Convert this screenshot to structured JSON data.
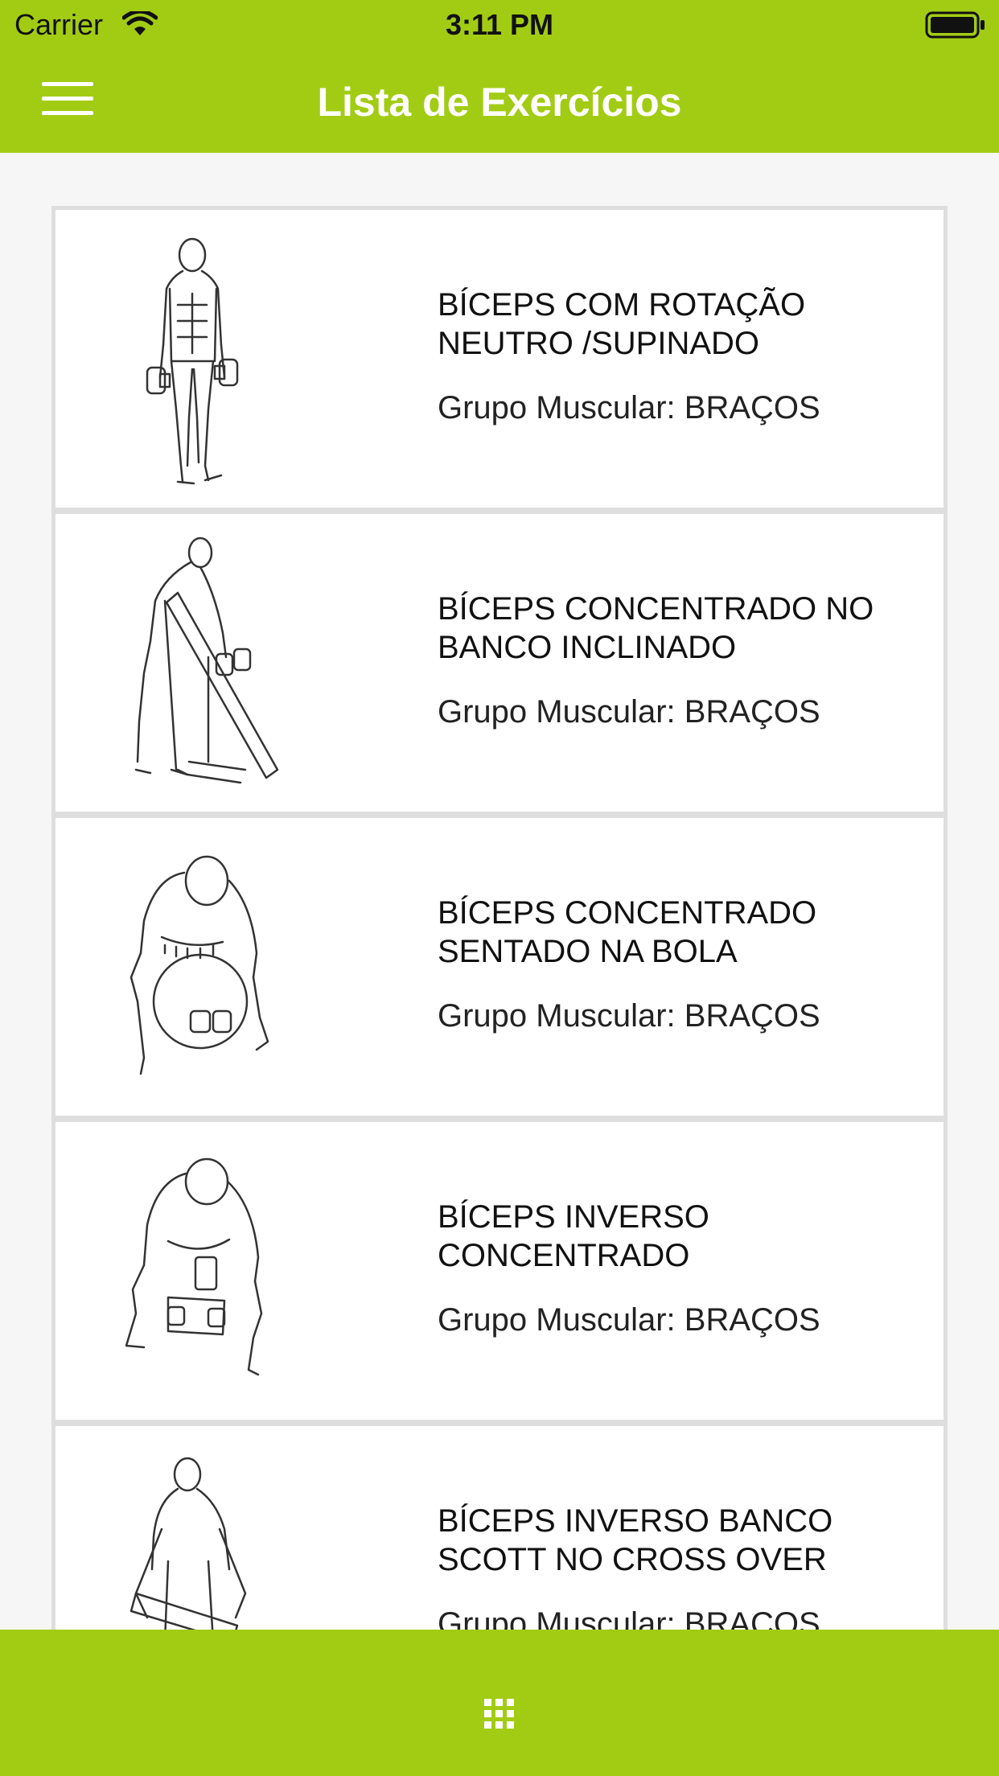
{
  "status": {
    "carrier": "Carrier",
    "time": "3:11 PM"
  },
  "nav": {
    "title": "Lista de Exercícios",
    "menu_icon": "hamburger-menu-icon"
  },
  "colors": {
    "accent": "#a2cc14",
    "background": "#f6f6f6",
    "card_border": "#dedede"
  },
  "items": [
    {
      "title": "BÍCEPS COM ROTAÇÃO NEUTRO /SUPINADO",
      "group": "Grupo Muscular: BRAÇOS",
      "image": "standing-dumbbell-curl-illustration"
    },
    {
      "title": "BÍCEPS CONCENTRADO NO BANCO INCLINADO",
      "group": "Grupo Muscular: BRAÇOS",
      "image": "incline-bench-curl-illustration"
    },
    {
      "title": "BÍCEPS CONCENTRADO SENTADO NA BOLA",
      "group": "Grupo Muscular: BRAÇOS",
      "image": "ball-concentration-curl-illustration"
    },
    {
      "title": "BÍCEPS INVERSO CONCENTRADO",
      "group": "Grupo Muscular: BRAÇOS",
      "image": "reverse-concentration-curl-illustration"
    },
    {
      "title": "BÍCEPS INVERSO BANCO SCOTT NO CROSS OVER",
      "group": "Grupo Muscular: BRAÇOS",
      "image": "scott-bench-cable-curl-illustration"
    }
  ],
  "footer": {
    "icon": "grid-icon"
  }
}
